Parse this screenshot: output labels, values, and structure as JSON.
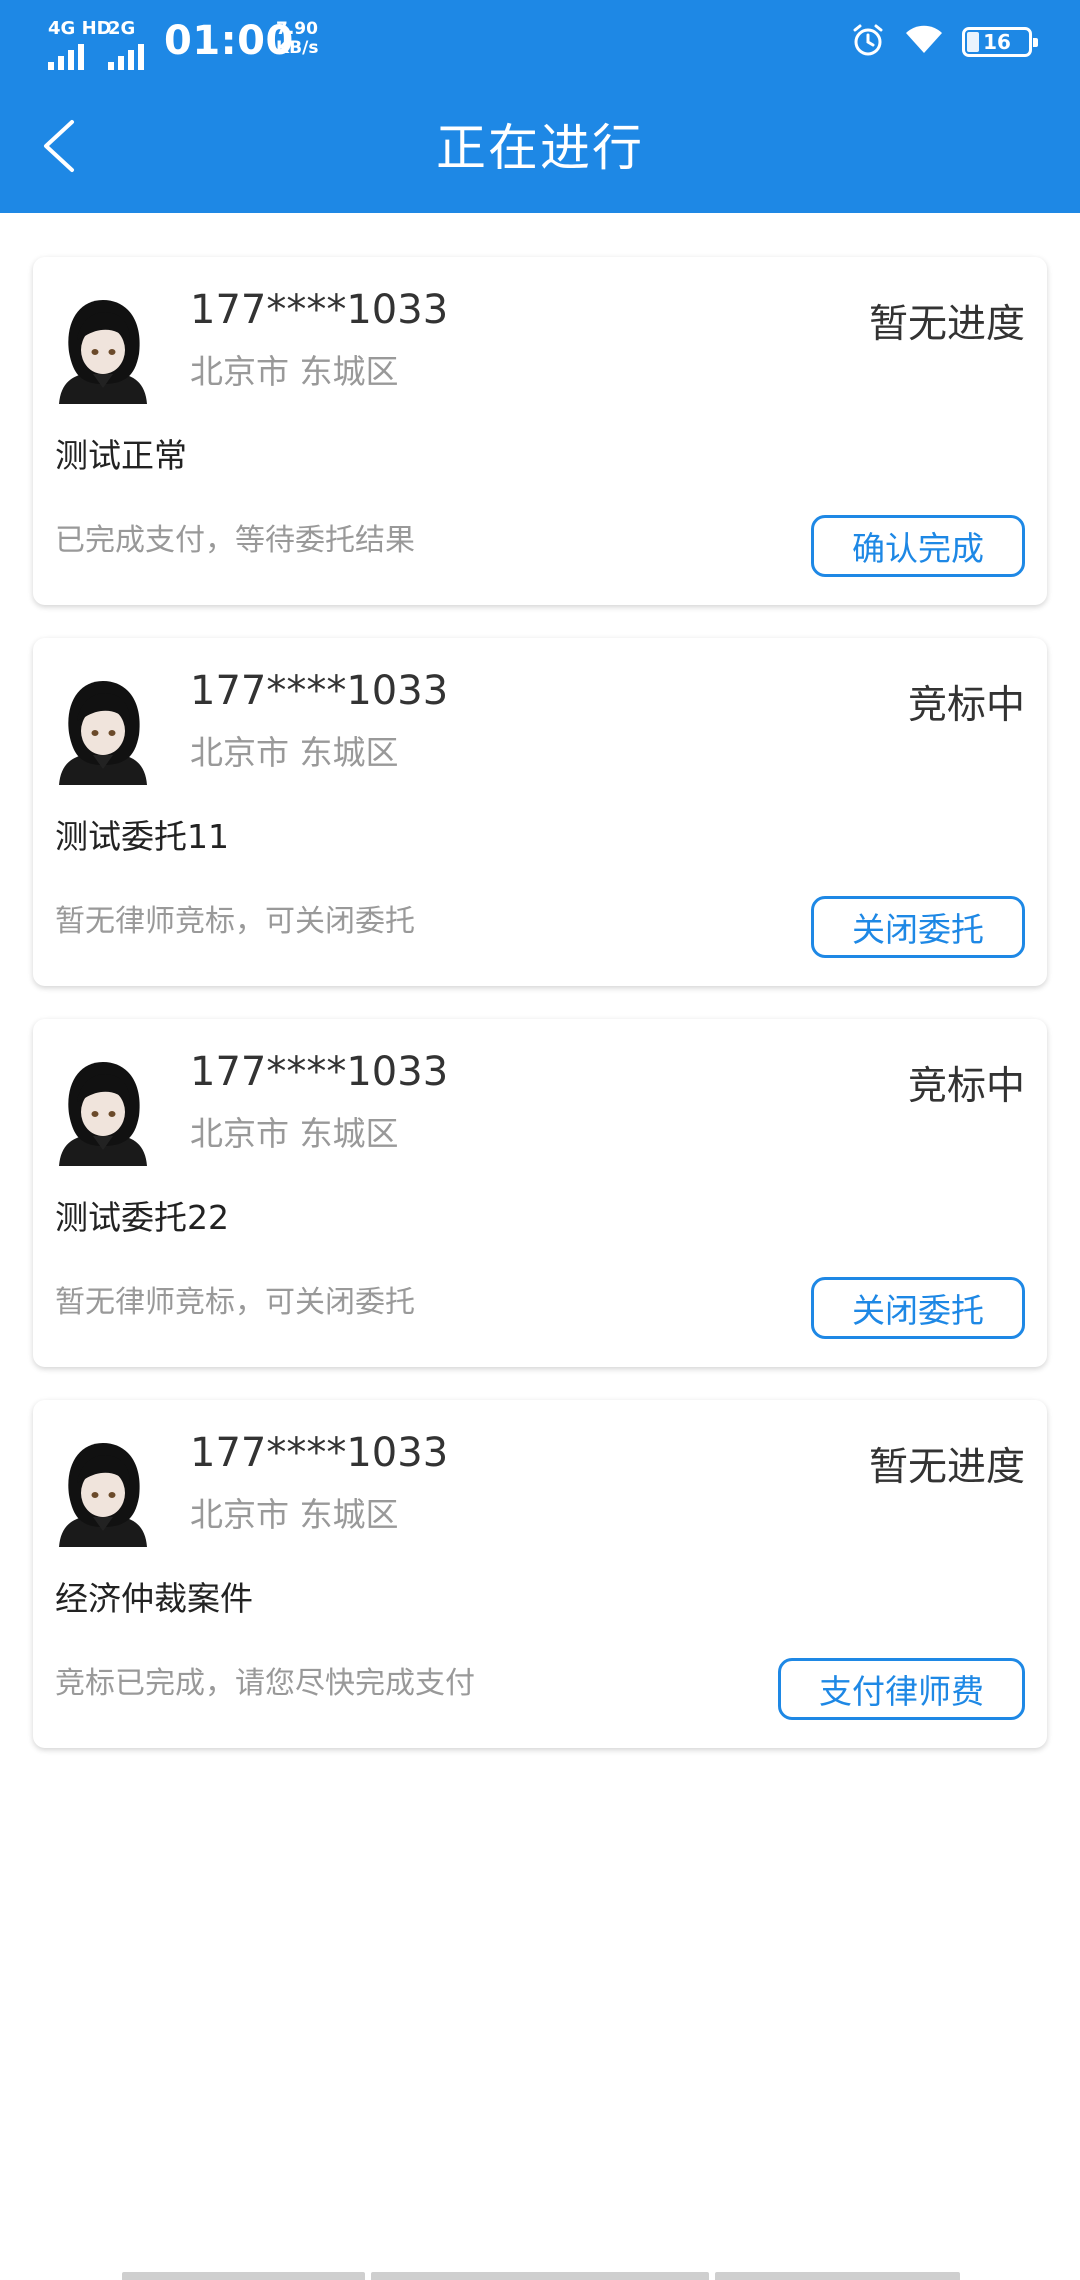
{
  "status_bar": {
    "network_1": "4G HD",
    "network_2": "2G",
    "time": "01:00",
    "speed_value": "7.90",
    "speed_unit": "KB/s",
    "battery": "16"
  },
  "header": {
    "title": "正在进行"
  },
  "colors": {
    "primary": "#1e88e5",
    "text_primary": "#333333",
    "text_secondary": "#999999"
  },
  "cases": [
    {
      "phone": "177****1033",
      "region": "北京市 东城区",
      "status": "暂无进度",
      "title": "测试正常",
      "note": "已完成支付，等待委托结果",
      "action": "确认完成"
    },
    {
      "phone": "177****1033",
      "region": "北京市 东城区",
      "status": "竞标中",
      "title": "测试委托11",
      "note": "暂无律师竞标，可关闭委托",
      "action": "关闭委托"
    },
    {
      "phone": "177****1033",
      "region": "北京市 东城区",
      "status": "竞标中",
      "title": "测试委托22",
      "note": "暂无律师竞标，可关闭委托",
      "action": "关闭委托"
    },
    {
      "phone": "177****1033",
      "region": "北京市 东城区",
      "status": "暂无进度",
      "title": "经济仲裁案件",
      "note": "竞标已完成，请您尽快完成支付",
      "action": "支付律师费"
    }
  ]
}
